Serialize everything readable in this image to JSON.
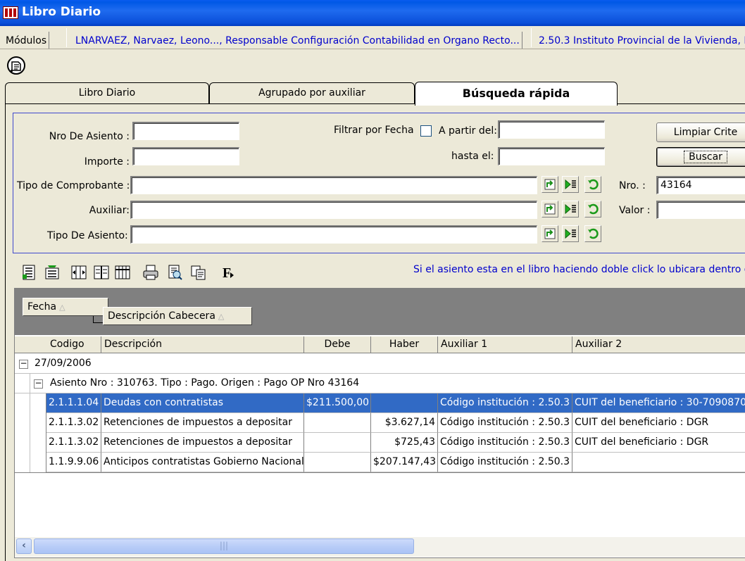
{
  "window": {
    "title": "Libro Diario"
  },
  "statusbar": {
    "modules_label": "Módulos",
    "user": "LNARVAEZ, Narvaez, Leono..., Responsable Configuración Contabilidad en Organo Recto...",
    "institution": "2.50.3 Instituto Provincial de la Vivienda, P"
  },
  "tabs": [
    {
      "label": "Libro Diario",
      "active": false
    },
    {
      "label": "Agrupado por auxiliar",
      "active": false
    },
    {
      "label": "Búsqueda rápida",
      "active": true
    }
  ],
  "criteria": {
    "nro_asiento_label": "Nro De Asiento :",
    "nro_asiento_value": "",
    "importe_label": "Importe :",
    "importe_value": "",
    "filtrar_fecha_label": "Filtrar por Fecha",
    "filtrar_fecha_checked": false,
    "desde_label": "A partir del:",
    "desde_value": "",
    "hasta_label": "hasta el:",
    "hasta_value": "",
    "tipo_comprobante_label": "Tipo de Comprobante :",
    "tipo_comprobante_value": "",
    "auxiliar_label": "Auxiliar:",
    "auxiliar_value": "",
    "tipo_asiento_label": "Tipo De Asiento:",
    "tipo_asiento_value": "",
    "nro_label": "Nro. :",
    "nro_value": "43164",
    "valor_label": "Valor :",
    "valor_value": "",
    "limpiar_label": "Limpiar Crite",
    "buscar_label": "Buscar"
  },
  "hint": "Si el asiento esta en el libro haciendo doble click lo ubicara dentro de",
  "grid": {
    "group_by": [
      {
        "label": "Fecha"
      },
      {
        "label": "Descripción Cabecera"
      }
    ],
    "columns": [
      "Codigo",
      "Descripción",
      "Debe",
      "Haber",
      "Auxiliar 1",
      "Auxiliar 2"
    ],
    "group_date": "27/09/2006",
    "subgroup": "Asiento Nro : 310763. Tipo : Pago. Origen : Pago OP Nro  43164",
    "rows": [
      {
        "codigo": "2.1.1.1.04",
        "descripcion": "Deudas con contratistas",
        "debe": "$211.500,00",
        "haber": "",
        "aux1": "Código institución  : 2.50.3",
        "aux2": "CUIT del beneficiario : 30-7090870",
        "selected": true
      },
      {
        "codigo": "2.1.1.3.02",
        "descripcion": "Retenciones de impuestos a depositar",
        "debe": "",
        "haber": "$3.627,14",
        "aux1": "Código institución  : 2.50.3",
        "aux2": "CUIT del beneficiario : DGR",
        "selected": false
      },
      {
        "codigo": "2.1.1.3.02",
        "descripcion": "Retenciones de impuestos a depositar",
        "debe": "",
        "haber": "$725,43",
        "aux1": "Código institución  : 2.50.3",
        "aux2": "CUIT del beneficiario : DGR",
        "selected": false
      },
      {
        "codigo": "1.1.9.9.06",
        "descripcion": "Anticipos contratistas Gobierno Nacional",
        "debe": "",
        "haber": "$207.147,43",
        "aux1": "Código institución  : 2.50.3",
        "aux2": "",
        "selected": false
      }
    ]
  },
  "colors": {
    "title_blue": "#0058e6",
    "selection": "#316ac5",
    "link_blue": "#0000cc"
  }
}
